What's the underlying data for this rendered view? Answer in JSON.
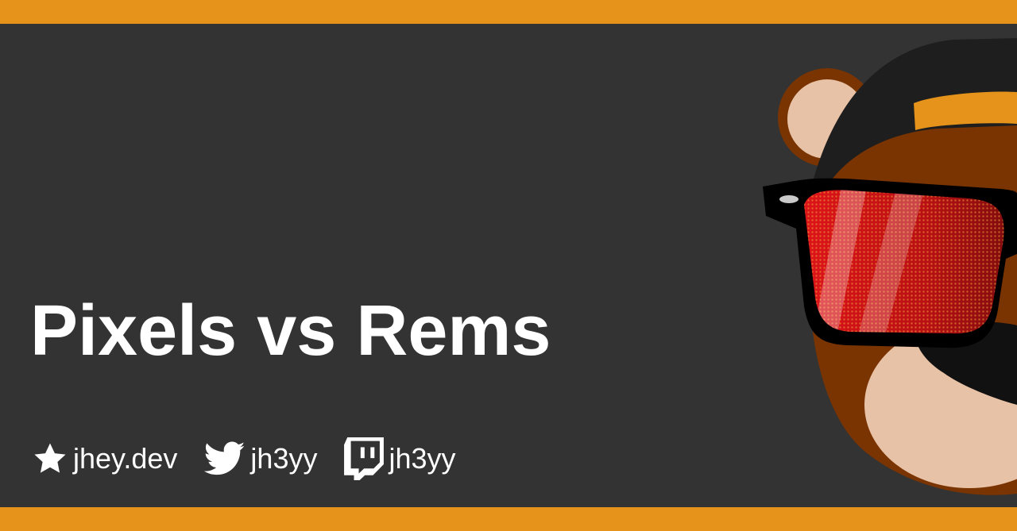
{
  "card": {
    "title": "Pixels vs Rems",
    "accent_color": "#e5931a",
    "background_color": "#333333"
  },
  "links": [
    {
      "icon": "star-icon",
      "label": "jhey.dev"
    },
    {
      "icon": "twitter-icon",
      "label": "jh3yy"
    },
    {
      "icon": "twitch-icon",
      "label": "jh3yy"
    }
  ],
  "mascot": {
    "icon": "bear-with-sunglasses-icon"
  }
}
